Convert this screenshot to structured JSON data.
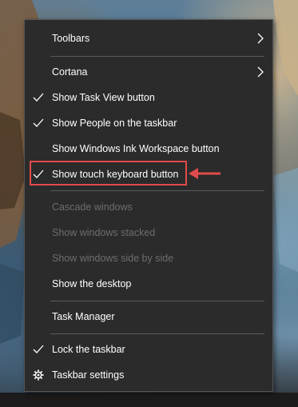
{
  "menu": {
    "items": [
      {
        "label": "Toolbars",
        "checked": false,
        "submenu": true,
        "enabled": true
      },
      {
        "label": "Cortana",
        "checked": false,
        "submenu": true,
        "enabled": true
      },
      {
        "label": "Show Task View button",
        "checked": true,
        "submenu": false,
        "enabled": true
      },
      {
        "label": "Show People on the taskbar",
        "checked": true,
        "submenu": false,
        "enabled": true
      },
      {
        "label": "Show Windows Ink Workspace button",
        "checked": false,
        "submenu": false,
        "enabled": true
      },
      {
        "label": "Show touch keyboard button",
        "checked": true,
        "submenu": false,
        "enabled": true
      },
      {
        "label": "Cascade windows",
        "checked": false,
        "submenu": false,
        "enabled": false
      },
      {
        "label": "Show windows stacked",
        "checked": false,
        "submenu": false,
        "enabled": false
      },
      {
        "label": "Show windows side by side",
        "checked": false,
        "submenu": false,
        "enabled": false
      },
      {
        "label": "Show the desktop",
        "checked": false,
        "submenu": false,
        "enabled": true
      },
      {
        "label": "Task Manager",
        "checked": false,
        "submenu": false,
        "enabled": true
      },
      {
        "label": "Lock the taskbar",
        "checked": true,
        "submenu": false,
        "enabled": true
      },
      {
        "label": "Taskbar settings",
        "checked": false,
        "submenu": false,
        "enabled": true,
        "icon": "gear-icon"
      }
    ]
  },
  "annotation": {
    "highlighted_item": "Show touch keyboard button",
    "color": "#e24b4b"
  },
  "colors": {
    "menu_background": "#2b2b2b",
    "text": "#ffffff",
    "disabled_text": "#6d6d6d",
    "separator": "#5a5a5a"
  }
}
